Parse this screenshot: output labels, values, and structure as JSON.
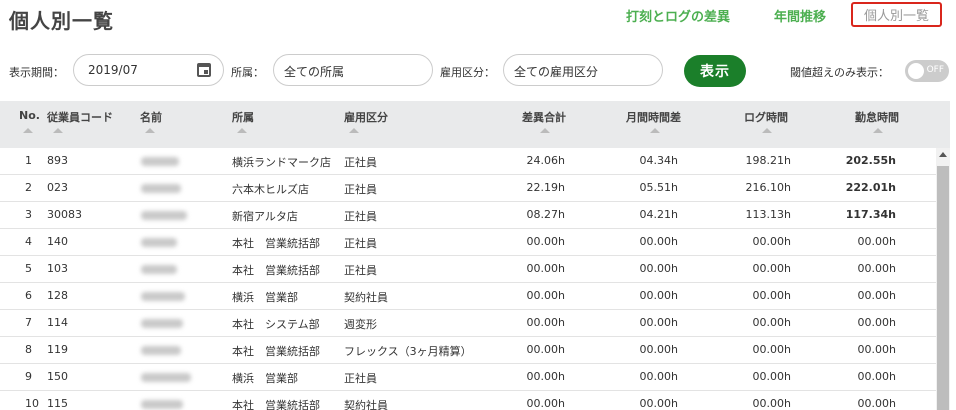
{
  "page_title": "個人別一覧",
  "nav": {
    "diff": "打刻とログの差異",
    "annual": "年間推移",
    "individual": "個人別一覧"
  },
  "filters": {
    "period_label": "表示期間：",
    "period_value": "2019/07",
    "dept_label": "所属：",
    "dept_value": "全ての所属",
    "emp_type_label": "雇用区分：",
    "emp_type_value": "全ての雇用区分",
    "show_button": "表示",
    "threshold_label": "閾値超えのみ表示：",
    "toggle_text": "OFF"
  },
  "table": {
    "headers": [
      "No.",
      "従業員コード",
      "名前",
      "所属",
      "雇用区分",
      "差異合計",
      "月間時間差",
      "ログ時間",
      "勤怠時間"
    ],
    "rows": [
      {
        "no": "1",
        "code": "893",
        "dept": "横浜ランドマーク店",
        "type": "正社員",
        "diff": "24.06h",
        "monthly": "04.34h",
        "log": "198.21h",
        "att": "202.55h",
        "bold": true
      },
      {
        "no": "2",
        "code": "023",
        "dept": "六本木ヒルズ店",
        "type": "正社員",
        "diff": "22.19h",
        "monthly": "05.51h",
        "log": "216.10h",
        "att": "222.01h",
        "bold": true
      },
      {
        "no": "3",
        "code": "30083",
        "dept": "新宿アルタ店",
        "type": "正社員",
        "diff": "08.27h",
        "monthly": "04.21h",
        "log": "113.13h",
        "att": "117.34h",
        "bold": true
      },
      {
        "no": "4",
        "code": "140",
        "dept": "本社　営業統括部",
        "type": "正社員",
        "diff": "00.00h",
        "monthly": "00.00h",
        "log": "00.00h",
        "att": "00.00h",
        "bold": false
      },
      {
        "no": "5",
        "code": "103",
        "dept": "本社　営業統括部",
        "type": "正社員",
        "diff": "00.00h",
        "monthly": "00.00h",
        "log": "00.00h",
        "att": "00.00h",
        "bold": false
      },
      {
        "no": "6",
        "code": "128",
        "dept": "横浜　営業部",
        "type": "契約社員",
        "diff": "00.00h",
        "monthly": "00.00h",
        "log": "00.00h",
        "att": "00.00h",
        "bold": false
      },
      {
        "no": "7",
        "code": "114",
        "dept": "本社　システム部",
        "type": "週変形",
        "diff": "00.00h",
        "monthly": "00.00h",
        "log": "00.00h",
        "att": "00.00h",
        "bold": false
      },
      {
        "no": "8",
        "code": "119",
        "dept": "本社　営業統括部",
        "type": "フレックス（3ヶ月精算）",
        "diff": "00.00h",
        "monthly": "00.00h",
        "log": "00.00h",
        "att": "00.00h",
        "bold": false
      },
      {
        "no": "9",
        "code": "150",
        "dept": "横浜　営業部",
        "type": "正社員",
        "diff": "00.00h",
        "monthly": "00.00h",
        "log": "00.00h",
        "att": "00.00h",
        "bold": false
      },
      {
        "no": "10",
        "code": "115",
        "dept": "本社　営業統括部",
        "type": "契約社員",
        "diff": "00.00h",
        "monthly": "00.00h",
        "log": "00.00h",
        "att": "00.00h",
        "bold": false
      }
    ]
  },
  "colors": {
    "accent_green": "#4caf50",
    "button_green": "#1b7f2a",
    "highlight_red": "#d9261c"
  }
}
